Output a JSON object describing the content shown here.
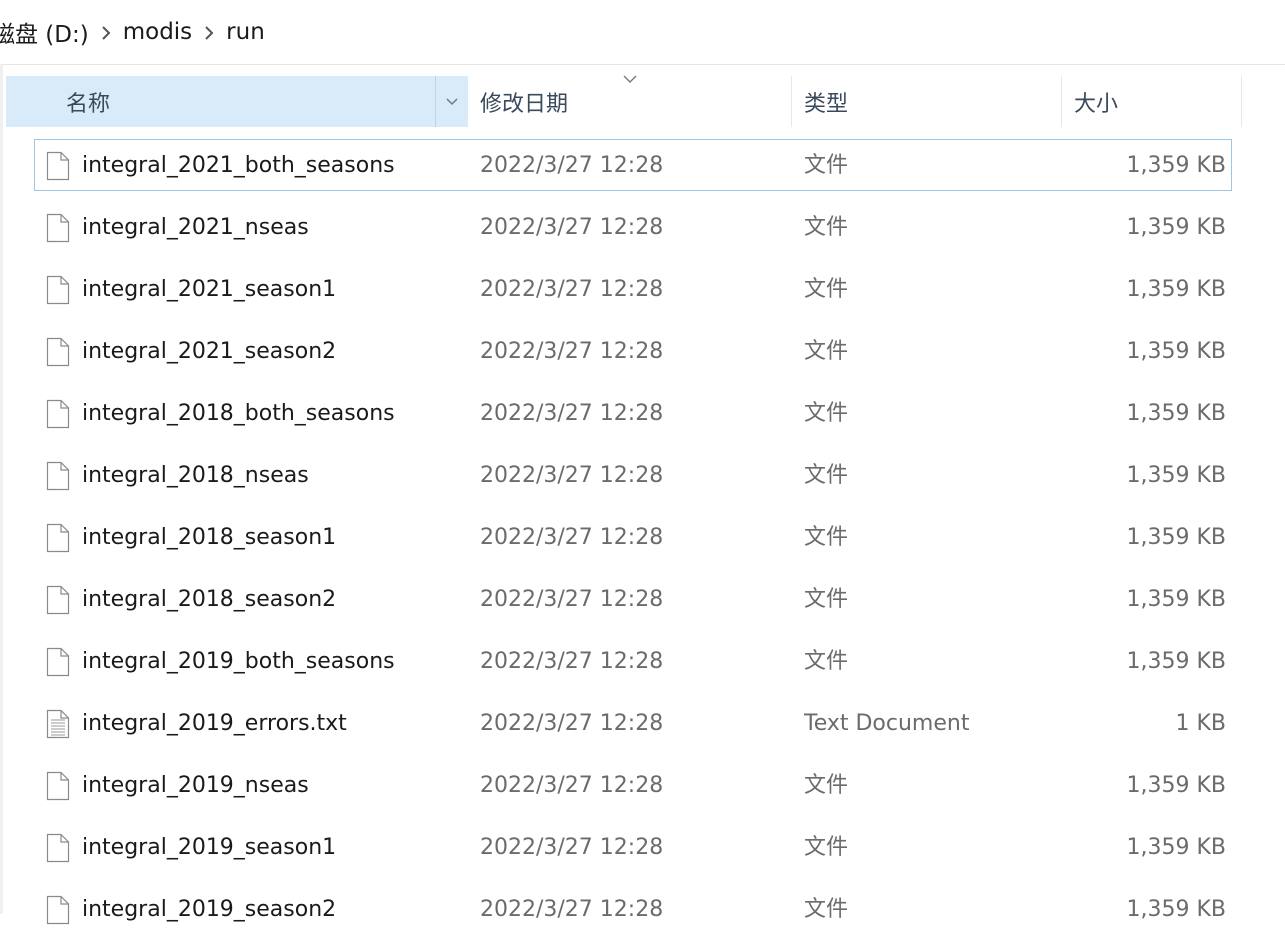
{
  "breadcrumb": [
    "磁盘 (D:)",
    "modis",
    "run"
  ],
  "columns": {
    "name": "名称",
    "date": "修改日期",
    "type": "类型",
    "size": "大小"
  },
  "files": [
    {
      "name": "integral_2021_both_seasons",
      "date": "2022/3/27 12:28",
      "type": "文件",
      "size": "1,359 KB",
      "icon": "file-icon"
    },
    {
      "name": "integral_2021_nseas",
      "date": "2022/3/27 12:28",
      "type": "文件",
      "size": "1,359 KB",
      "icon": "file-icon"
    },
    {
      "name": "integral_2021_season1",
      "date": "2022/3/27 12:28",
      "type": "文件",
      "size": "1,359 KB",
      "icon": "file-icon"
    },
    {
      "name": "integral_2021_season2",
      "date": "2022/3/27 12:28",
      "type": "文件",
      "size": "1,359 KB",
      "icon": "file-icon"
    },
    {
      "name": "integral_2018_both_seasons",
      "date": "2022/3/27 12:28",
      "type": "文件",
      "size": "1,359 KB",
      "icon": "file-icon"
    },
    {
      "name": "integral_2018_nseas",
      "date": "2022/3/27 12:28",
      "type": "文件",
      "size": "1,359 KB",
      "icon": "file-icon"
    },
    {
      "name": "integral_2018_season1",
      "date": "2022/3/27 12:28",
      "type": "文件",
      "size": "1,359 KB",
      "icon": "file-icon"
    },
    {
      "name": "integral_2018_season2",
      "date": "2022/3/27 12:28",
      "type": "文件",
      "size": "1,359 KB",
      "icon": "file-icon"
    },
    {
      "name": "integral_2019_both_seasons",
      "date": "2022/3/27 12:28",
      "type": "文件",
      "size": "1,359 KB",
      "icon": "file-icon"
    },
    {
      "name": "integral_2019_errors.txt",
      "date": "2022/3/27 12:28",
      "type": "Text Document",
      "size": "1 KB",
      "icon": "text-document-icon"
    },
    {
      "name": "integral_2019_nseas",
      "date": "2022/3/27 12:28",
      "type": "文件",
      "size": "1,359 KB",
      "icon": "file-icon"
    },
    {
      "name": "integral_2019_season1",
      "date": "2022/3/27 12:28",
      "type": "文件",
      "size": "1,359 KB",
      "icon": "file-icon"
    },
    {
      "name": "integral_2019_season2",
      "date": "2022/3/27 12:28",
      "type": "文件",
      "size": "1,359 KB",
      "icon": "file-icon"
    }
  ],
  "colors": {
    "header_active_bg": "#d9eaf8",
    "selection_border": "#9cc7e8",
    "secondary_text": "#6b6b6b"
  }
}
